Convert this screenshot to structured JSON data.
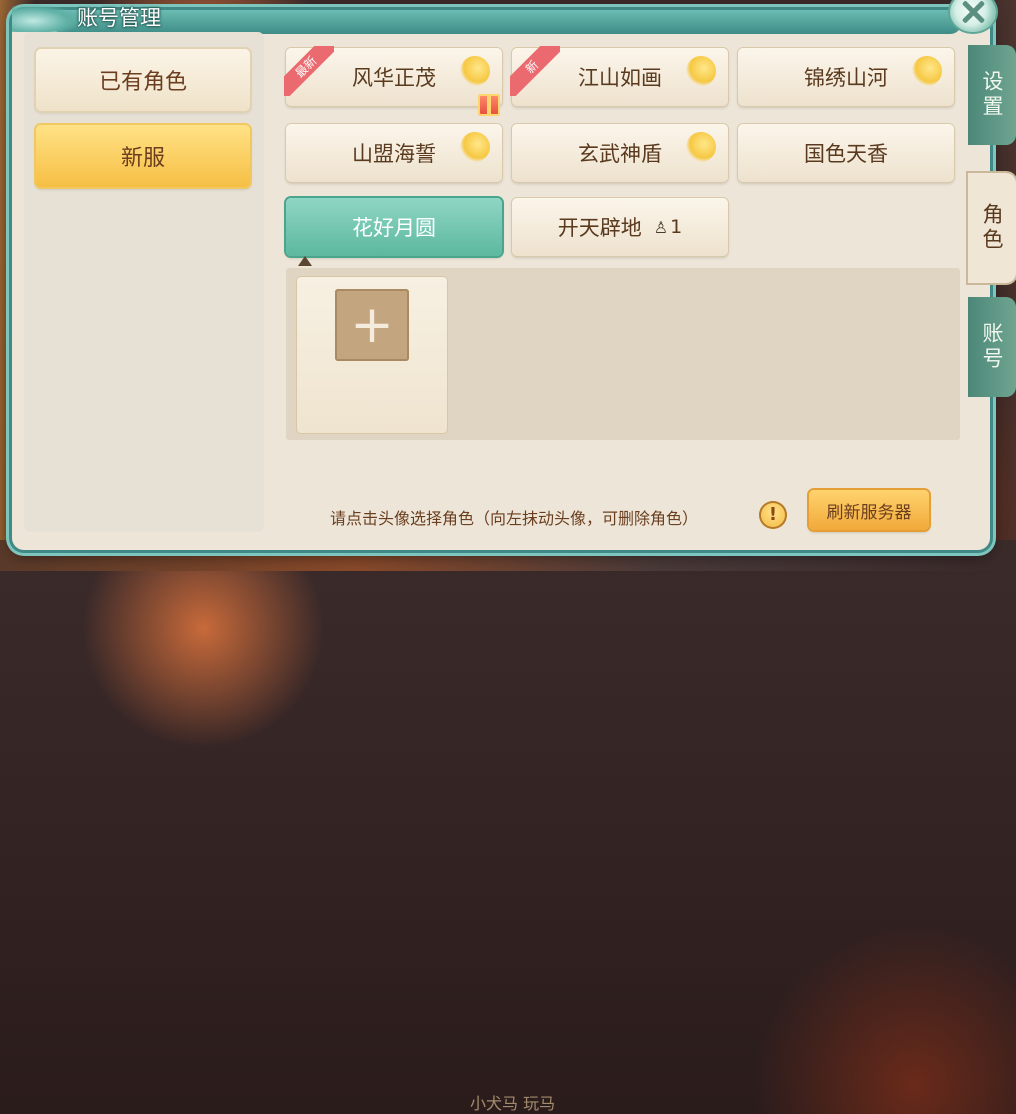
{
  "window": {
    "title": "账号管理"
  },
  "left_menu": {
    "items": [
      {
        "label": "已有角色"
      },
      {
        "label": "新服"
      }
    ]
  },
  "servers": [
    {
      "name": "风华正茂",
      "badge": "最新",
      "gift": true
    },
    {
      "name": "江山如画",
      "badge": "新"
    },
    {
      "name": "锦绣山河"
    },
    {
      "name": "山盟海誓"
    },
    {
      "name": "玄武神盾"
    },
    {
      "name": "国色天香"
    },
    {
      "name": "花好月圆",
      "selected": true
    },
    {
      "name": "开天辟地",
      "player_count": "1"
    }
  ],
  "hint": "请点击头像选择角色（向左抹动头像，可删除角色）",
  "warn_icon": "!",
  "add_icon": "+",
  "refresh_label": "刷新服务器",
  "side_tabs": [
    {
      "label": "设置"
    },
    {
      "label": "角色"
    },
    {
      "label": "账号"
    }
  ],
  "background": {
    "text": "小犬马  玩马"
  },
  "colors": {
    "teal": "#5cb89f",
    "gold": "#f6bf44",
    "text_brown": "#6b3e1f"
  }
}
